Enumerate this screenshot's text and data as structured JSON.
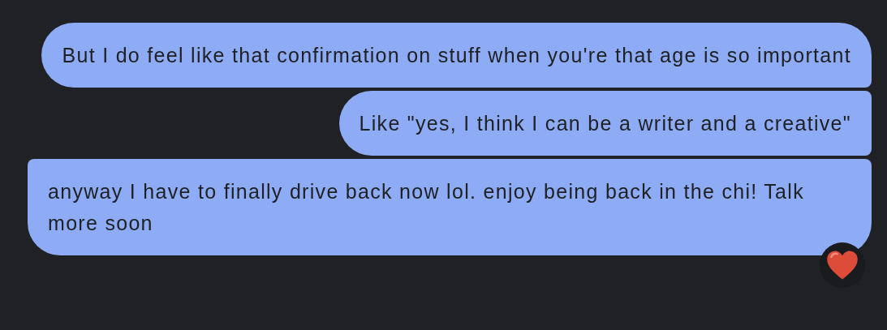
{
  "messages": [
    {
      "text": "But I do feel like that confirmation on stuff when you're that age is so important",
      "kind": "first"
    },
    {
      "text": "Like \"yes, I think I can be a writer and a creative\"",
      "kind": "middle"
    },
    {
      "text": "anyway I have to finally drive back now lol. enjoy being back in the chi! Talk more soon",
      "kind": "last",
      "reaction": {
        "kind": "heart"
      }
    }
  ]
}
